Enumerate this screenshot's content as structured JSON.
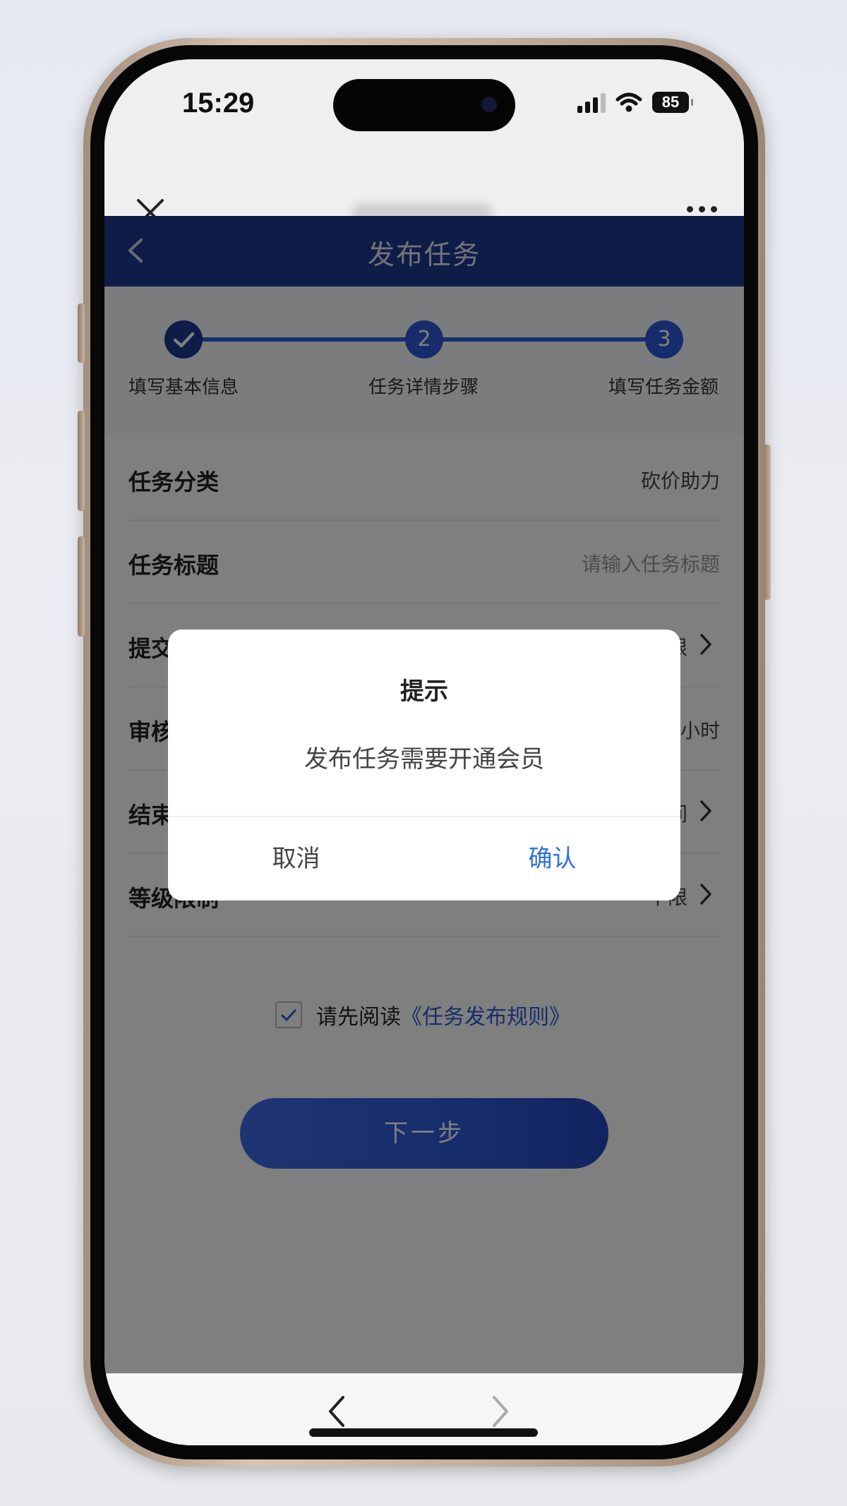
{
  "status_bar": {
    "time": "15:29",
    "battery": "85",
    "icons": [
      "signal-icon",
      "wifi-icon",
      "battery-icon"
    ]
  },
  "webview": {
    "close_icon": "close-icon",
    "more_icon": "more-icon"
  },
  "header": {
    "title": "发布任务",
    "back_icon": "chevron-left-icon",
    "bg_color": "#1c3a8e"
  },
  "steps": [
    {
      "number": "",
      "label": "填写基本信息",
      "state": "done"
    },
    {
      "number": "2",
      "label": "任务详情步骤",
      "state": "pending"
    },
    {
      "number": "3",
      "label": "填写任务金额",
      "state": "pending"
    }
  ],
  "form": {
    "rows": [
      {
        "label": "任务分类",
        "value": "砍价助力"
      },
      {
        "label": "任务标题",
        "placeholder": "请输入任务标题"
      },
      {
        "label": "提交",
        "value": "限"
      },
      {
        "label": "审核",
        "value": "小时"
      },
      {
        "label": "结束",
        "value": "间"
      },
      {
        "label": "等级限制",
        "value": "不限"
      }
    ]
  },
  "agreement": {
    "prefix": "请先阅读",
    "link": "《任务发布规则》",
    "checked": true
  },
  "next_button": {
    "label": "下一步"
  },
  "dialog": {
    "title": "提示",
    "message": "发布任务需要开通会员",
    "cancel": "取消",
    "confirm": "确认",
    "confirm_color": "#2f6fe0"
  },
  "bottom_nav": {
    "back_icon": "chevron-left-icon",
    "forward_icon": "chevron-right-icon"
  }
}
